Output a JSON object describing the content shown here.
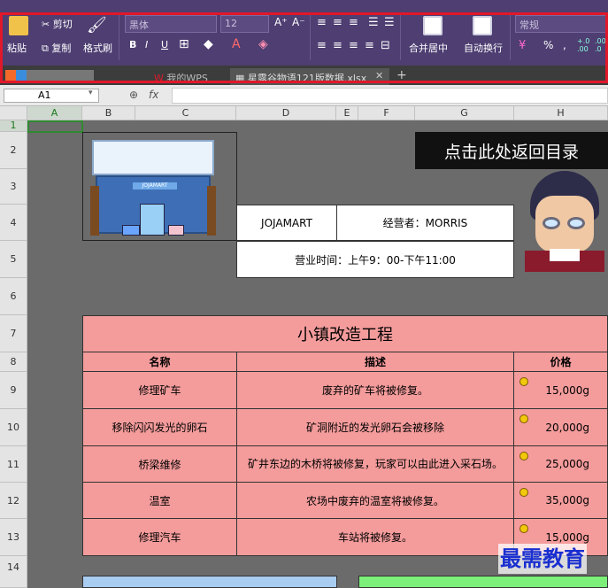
{
  "ribbon": {
    "paste": "粘贴",
    "cut": "剪切",
    "copy": "复制",
    "format_painter": "格式刷",
    "font_name": "黑体",
    "font_size": "12",
    "grow_font": "A⁺",
    "shrink_font": "A⁻",
    "bold": "B",
    "italic": "I",
    "underline": "U",
    "merge_center": "合并居中",
    "wrap_text": "自动换行",
    "number_format": "常规",
    "percent": "%",
    "thousands": ",",
    "increase_decimal": "⁺.0\n.00",
    "decrease_decimal": ".00\n→.0"
  },
  "tabs": [
    {
      "label": "我的WPS"
    },
    {
      "label": "星露谷物语121版数据.xlsx"
    }
  ],
  "formula_bar": {
    "cell_ref": "A1",
    "fx": "fx",
    "formula": ""
  },
  "columns": [
    "A",
    "B",
    "C",
    "D",
    "E",
    "F",
    "G",
    "H"
  ],
  "rows": [
    "1",
    "2",
    "3",
    "4",
    "5",
    "6",
    "7",
    "8",
    "9",
    "10",
    "11",
    "12",
    "13",
    "14"
  ],
  "sheet": {
    "back_button": "点击此处返回目录",
    "store_sign": "JOJAMART",
    "store_name": "JOJAMART",
    "owner": "经营者：MORRIS",
    "hours": "营业时间：上午9：00-下午11:00",
    "table_title": "小镇改造工程",
    "headers": [
      "名称",
      "描述",
      "价格"
    ],
    "items": [
      {
        "name": "修理矿车",
        "desc": "废弃的矿车将被修复。",
        "price": "15,000g"
      },
      {
        "name": "移除闪闪发光的卵石",
        "desc": "矿洞附近的发光卵石会被移除",
        "price": "20,000g"
      },
      {
        "name": "桥梁维修",
        "desc": "矿井东边的木桥将被修复，玩家可以由此进入采石场。",
        "price": "25,000g"
      },
      {
        "name": "温室",
        "desc": "农场中废弃的温室将被修复。",
        "price": "35,000g"
      },
      {
        "name": "修理汽车",
        "desc": "车站将被修复。",
        "price": "15,000g"
      }
    ]
  },
  "watermark": "最需教育",
  "colors": {
    "ribbon": "#4e3e72",
    "sheet_bg": "#6b6b6b",
    "table_pink": "#f49b9b",
    "highlight_red": "#e0182a"
  }
}
